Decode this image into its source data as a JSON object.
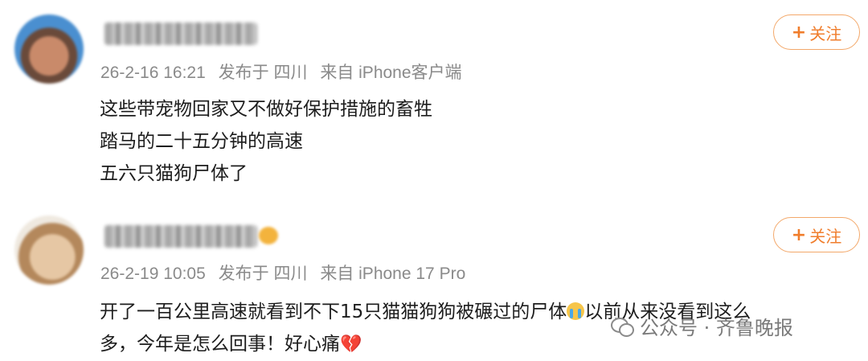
{
  "posts": [
    {
      "meta": {
        "date": "26-2-16 16:21",
        "location": "发布于 四川",
        "device": "来自 iPhone客户端"
      },
      "follow_label": "关注",
      "content_lines": [
        "这些带宠物回家又不做好保护措施的畜牲",
        "踏马的二十五分钟的高速",
        "五六只猫狗尸体了"
      ]
    },
    {
      "meta": {
        "date": "26-2-19 10:05",
        "location": "发布于 四川",
        "device": "来自 iPhone 17 Pro"
      },
      "follow_label": "关注",
      "content_line1_a": "开了一百公里高速就看到不下15只猫猫狗狗被碾过的尸体",
      "content_line1_b": "以前从来没看到这么",
      "content_line2": "多，今年是怎么回事！好心痛"
    }
  ],
  "watermark": {
    "text": "公众号 · 齐鲁晚报"
  },
  "icons": {
    "follow_plus": "plus-icon",
    "cry": "crying-face-emoji",
    "heart": "broken-heart-emoji",
    "watermark": "wechat-icon"
  },
  "colors": {
    "accent": "#f07d2c",
    "meta": "#8a8a8a",
    "text": "#1d1d1d"
  }
}
